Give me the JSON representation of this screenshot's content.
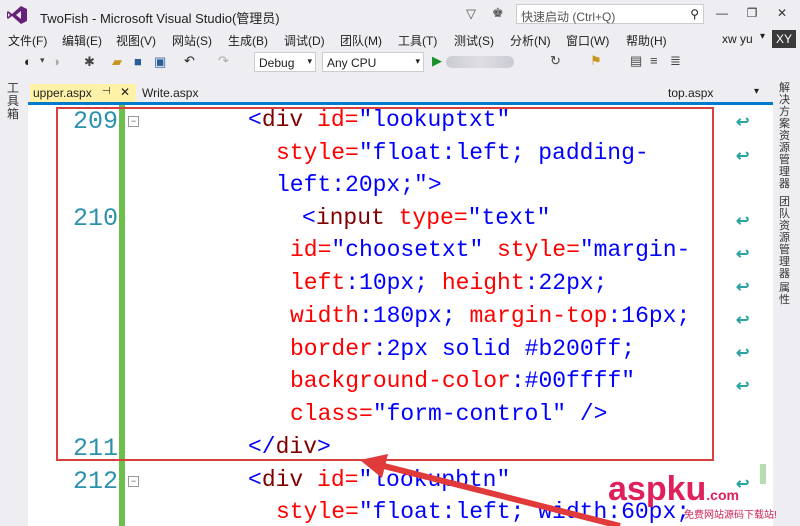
{
  "window": {
    "title": "TwoFish - Microsoft Visual Studio(管理员)",
    "quick_launch_placeholder": "快速启动 (Ctrl+Q)",
    "minimize": "—",
    "restore": "❐",
    "close": "✕"
  },
  "menu": [
    "文件(F)",
    "编辑(E)",
    "视图(V)",
    "网站(S)",
    "生成(B)",
    "调试(D)",
    "团队(M)",
    "工具(T)",
    "测试(S)",
    "分析(N)",
    "窗口(W)",
    "帮助(H)"
  ],
  "user": {
    "name": "xw yu",
    "initials": "XY"
  },
  "toolbar": {
    "config": "Debug",
    "platform": "Any CPU"
  },
  "left_sidebar": {
    "label": "工具箱"
  },
  "tabs": {
    "active": "upper.aspx",
    "second": "Write.aspx",
    "right": "top.aspx"
  },
  "right_sidebar": {
    "labels": [
      "解决方案资源管理器",
      "团队资源管理器",
      "属性"
    ]
  },
  "editor": {
    "line_numbers": {
      "l209": "209",
      "l210": "210",
      "l211": "211",
      "l212": "212"
    },
    "code": [
      {
        "t": "<",
        "n": "div",
        "a": " id=",
        "v": "\"lookuptxt\""
      },
      {
        "a2": "style=",
        "v2": "\"float:left; padding-"
      },
      {
        "v3": "left:20px;\"",
        "t3": ">"
      },
      {
        "t4": "<",
        "n4": "input",
        "a4": " type=",
        "v4": "\"text\""
      },
      {
        "a5": "id=",
        "v5": "\"choosetxt\"",
        "a5b": " style=",
        "v5b": "\"margin-"
      },
      {
        "p6": "left",
        "s6": ":10px; ",
        "p6b": "height",
        "s6b": ":22px;"
      },
      {
        "p7": "width",
        "s7": ":180px; ",
        "p7b": "margin-top",
        "s7b": ":16px;"
      },
      {
        "p8": "border",
        "s8": ":2px solid #b200ff;"
      },
      {
        "p9": "background-color",
        "s9": ":#00ffff\""
      },
      {
        "a10": "class=",
        "v10": "\"form-control\"",
        "t10": " />"
      },
      {
        "t11": "</",
        "n11": "div",
        "t11b": ">"
      },
      {
        "t12": "<",
        "n12": "div",
        "a12": " id=",
        "v12": "\"lookupbtn\""
      },
      {
        "a13": "style=",
        "v13": "\"float:left; width:60px;"
      }
    ]
  },
  "watermark": {
    "text": "aspku",
    "dotcom": ".com",
    "sub": "免费网站源码下载站!"
  }
}
